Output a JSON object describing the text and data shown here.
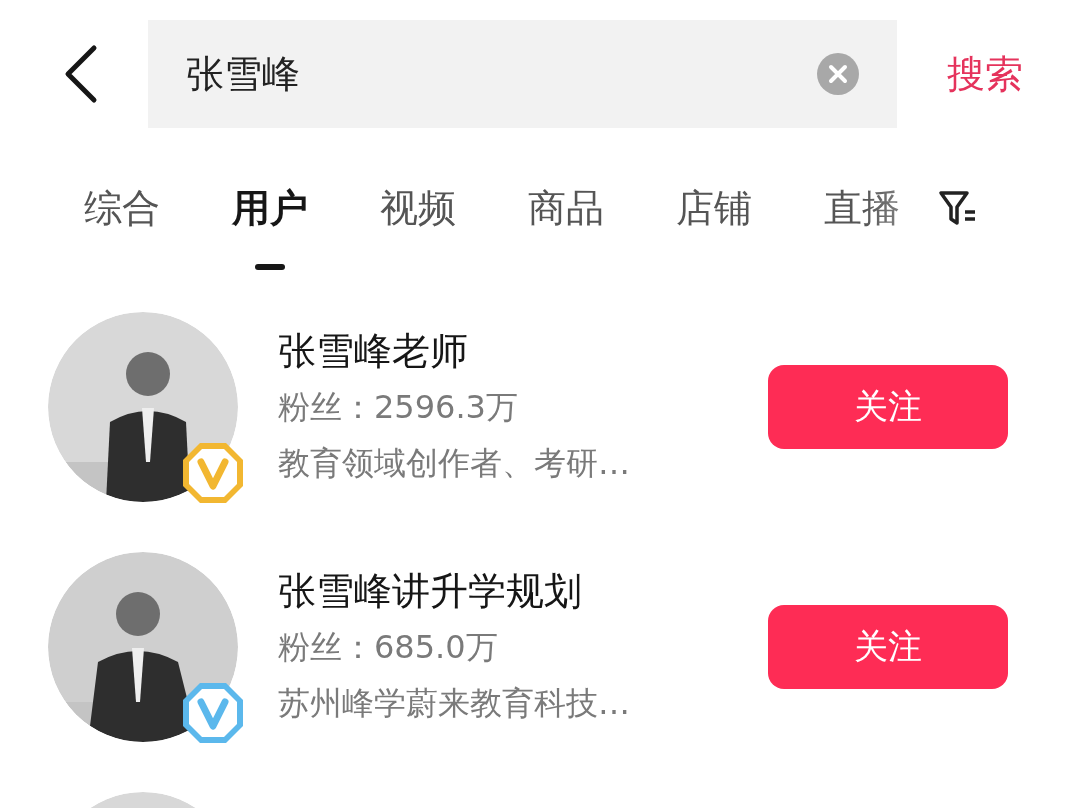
{
  "search": {
    "value": "张雪峰",
    "submit": "搜索"
  },
  "tabs": [
    {
      "label": "综合",
      "selected": false
    },
    {
      "label": "用户",
      "selected": true
    },
    {
      "label": "视频",
      "selected": false
    },
    {
      "label": "商品",
      "selected": false
    },
    {
      "label": "店铺",
      "selected": false
    },
    {
      "label": "直播",
      "selected": false
    }
  ],
  "users": [
    {
      "kind": "account",
      "name": "张雪峰老师",
      "followers": "粉丝：2596.3万",
      "bio": "教育领域创作者、考研…",
      "color": "#f2b731",
      "follow": "关注"
    },
    {
      "kind": "account",
      "name": "张雪峰讲升学规划",
      "followers": "粉丝：685.0万",
      "bio": "苏州峰学蔚来教育科技…",
      "color": "#5bb8ec",
      "follow": "关注"
    },
    {
      "kind": "picture"
    }
  ]
}
